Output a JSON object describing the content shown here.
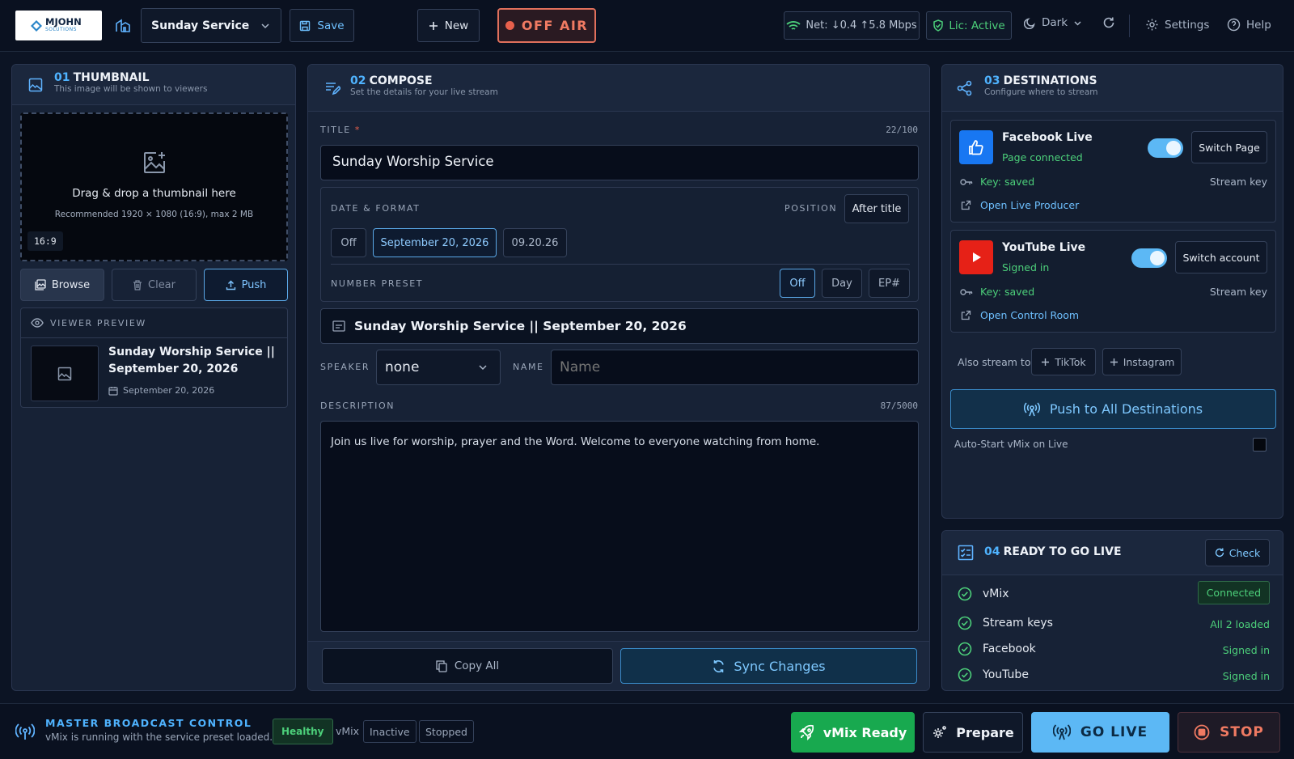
{
  "brand": {
    "logo_text": "MJOHN",
    "logo_sub": "SOLUTIONS"
  },
  "topbar": {
    "service": "Sunday Service",
    "save": "Save",
    "new": "New",
    "off_air": "OFF AIR",
    "net": "Net: ↓0.4 ↑5.8 Mbps",
    "license": "Lic: Active",
    "theme": "Dark",
    "settings": "Settings",
    "help": "Help"
  },
  "thumbnail": {
    "num": "01",
    "title": "THUMBNAIL",
    "subtitle": "This image will be shown to viewers",
    "drop_text": "Drag & drop a thumbnail here",
    "recommend": "Recommended 1920 × 1080 (16:9), max 2 MB",
    "aspect": "16:9",
    "browse": "Browse",
    "clear": "Clear",
    "push": "Push",
    "preview_label": "VIEWER PREVIEW",
    "preview_title": "Sunday Worship Service || September 20, 2026",
    "preview_date": "September 20, 2026"
  },
  "compose": {
    "num": "02",
    "title": "COMPOSE",
    "subtitle": "Set the details for your live stream",
    "title_label": "TITLE",
    "required": "*",
    "title_count": "22/100",
    "title_value": "Sunday Worship Service",
    "date_label": "DATE & FORMAT",
    "position_label": "POSITION",
    "position_value": "After title",
    "date_opts": [
      "Off",
      "September 20, 2026",
      "09.20.26"
    ],
    "number_label": "NUMBER PRESET",
    "number_opts": [
      "Off",
      "Day",
      "EP#"
    ],
    "final_title": "Sunday Worship Service || September 20, 2026",
    "speaker_label": "SPEAKER",
    "speaker_value": "none",
    "name_label": "NAME",
    "name_placeholder": "Name",
    "desc_label": "DESCRIPTION",
    "desc_count": "87/5000",
    "desc_value": "Join us live for worship, prayer and the Word. Welcome to everyone watching from home.",
    "copy_all": "Copy All",
    "sync": "Sync Changes"
  },
  "destinations": {
    "num": "03",
    "title": "DESTINATIONS",
    "subtitle": "Configure where to stream",
    "facebook": {
      "name": "Facebook Live",
      "status": "Page connected",
      "switch": "Switch Page",
      "key": "Key: saved",
      "stream_key": "Stream key",
      "link": "Open Live Producer",
      "enabled": true
    },
    "youtube": {
      "name": "YouTube Live",
      "status": "Signed in",
      "switch": "Switch account",
      "key": "Key: saved",
      "stream_key": "Stream key",
      "link": "Open Control Room",
      "enabled": true
    },
    "also_label": "Also stream to",
    "also": [
      "TikTok",
      "Instagram"
    ],
    "push_all": "Push to All Destinations",
    "autostart": "Auto-Start vMix on Live",
    "autostart_checked": false
  },
  "ready": {
    "num": "04",
    "title": "READY TO GO LIVE",
    "check": "Check",
    "items": [
      {
        "label": "vMix",
        "status": "Connected"
      },
      {
        "label": "Stream keys",
        "status": "All 2 loaded"
      },
      {
        "label": "Facebook",
        "status": "Signed in"
      },
      {
        "label": "YouTube",
        "status": "Signed in"
      }
    ]
  },
  "footer": {
    "title": "MASTER BROADCAST CONTROL",
    "subtitle": "vMix is running with the service preset loaded.",
    "healthy": "Healthy",
    "vmix": "vMix",
    "inactive": "Inactive",
    "stopped": "Stopped",
    "vmix_ready": "vMix Ready",
    "prepare": "Prepare",
    "go_live": "GO LIVE",
    "stop": "STOP"
  },
  "colors": {
    "accent": "#4fb3ff",
    "green": "#18a94f",
    "live": "#5cb8f5",
    "danger": "#e8604c"
  }
}
